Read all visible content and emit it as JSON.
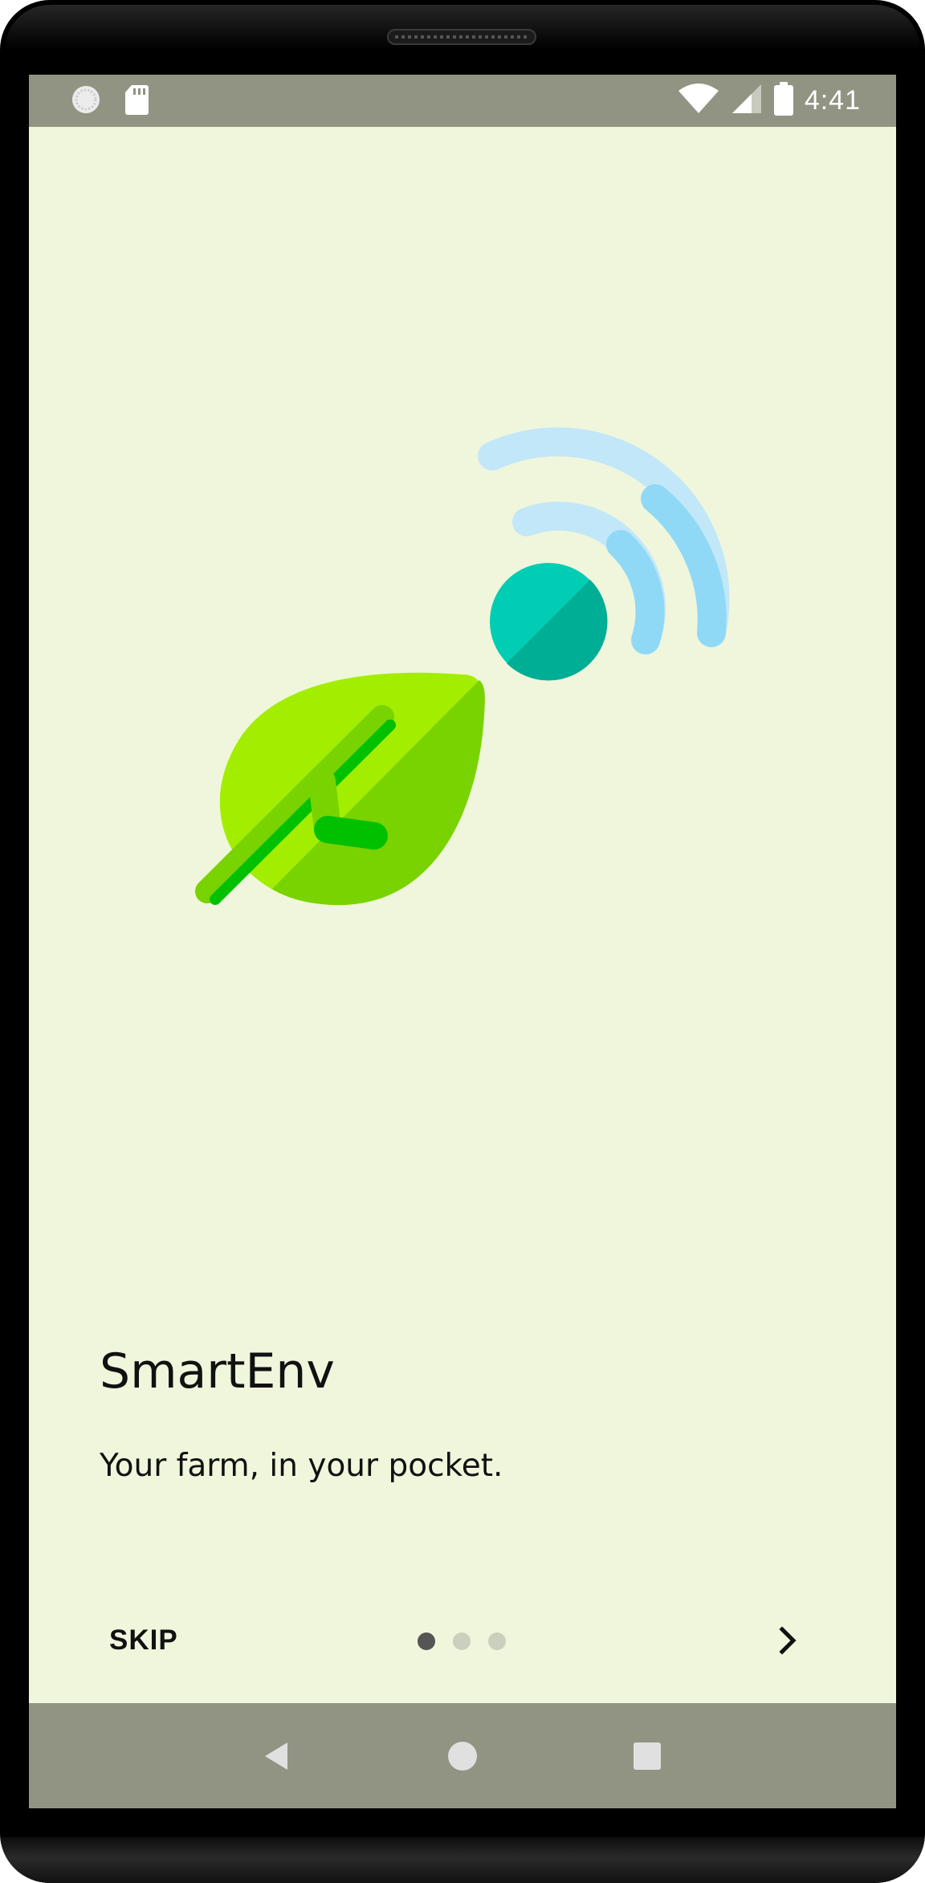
{
  "status_bar": {
    "time": "4:41",
    "left_icons": [
      "sync-icon",
      "sd-card-icon"
    ],
    "right_icons": [
      "wifi-icon",
      "signal-icon",
      "battery-icon"
    ]
  },
  "onboarding": {
    "illustration": "leaf-with-wireless-signal",
    "title": "SmartEnv",
    "subtitle": "Your farm, in your pocket.",
    "skip_label": "SKIP",
    "pages_total": 3,
    "current_page": 1,
    "next_icon": "chevron-right-icon"
  },
  "nav_bar": {
    "buttons": [
      "back-icon",
      "home-icon",
      "recents-icon"
    ]
  },
  "colors": {
    "background": "#f0f6dc",
    "system_bars": "#919482",
    "leaf_light": "#a3ee00",
    "leaf_dark": "#79d300",
    "stem": "#00c000",
    "sensor_teal": "#00cdb3",
    "signal_blue": "#8fd9f6"
  }
}
